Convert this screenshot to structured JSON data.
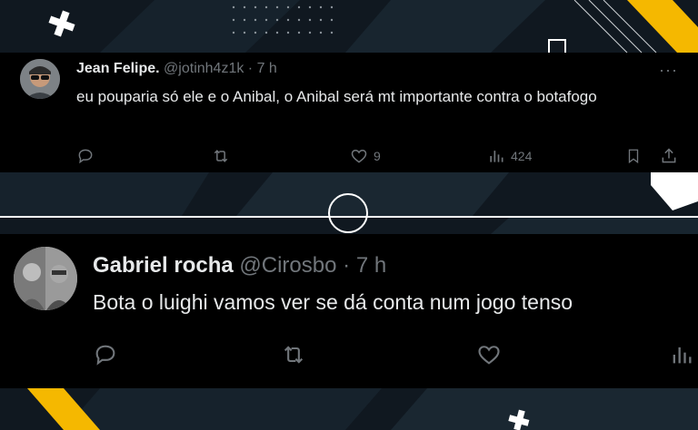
{
  "colors": {
    "background": "#101820",
    "card": "#000000",
    "text": "#e7e9ea",
    "muted": "#71767b",
    "accent_yellow": "#f5b800"
  },
  "tweets": [
    {
      "name": "Jean Felipe.",
      "handle": "@jotinh4z1k",
      "dot": "·",
      "time": "7 h",
      "text": "eu pouparia só ele e o Anibal, o Anibal será mt importante contra o botafogo",
      "more": "···",
      "likes": "9",
      "views": "424",
      "icons": [
        "reply-icon",
        "retweet-icon",
        "like-icon",
        "views-icon",
        "bookmark-icon",
        "share-icon"
      ]
    },
    {
      "name": "Gabriel rocha",
      "handle": "@Cirosbo",
      "dot": "·",
      "time": "7 h",
      "text": "Bota o luighi vamos ver se dá conta num jogo tenso",
      "icons": [
        "reply-icon",
        "retweet-icon",
        "like-icon",
        "views-icon"
      ]
    }
  ]
}
